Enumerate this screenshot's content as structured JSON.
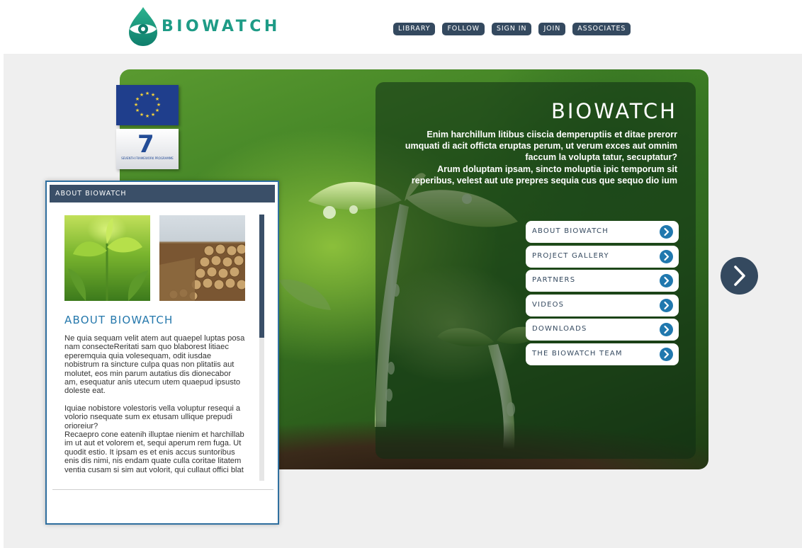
{
  "brand": {
    "name": "BIOWATCH",
    "color": "#1e9b86"
  },
  "topnav": [
    {
      "label": "LIBRARY"
    },
    {
      "label": "FOLLOW"
    },
    {
      "label": "SIGN IN"
    },
    {
      "label": "JOIN"
    },
    {
      "label": "ASSOCIATES"
    }
  ],
  "hero": {
    "title": "BIOWATCH",
    "description_1": "Enim harchillum litibus ciiscia demperuptiis et ditae prerorr umquati di acit officta eruptas perum, ut verum exces aut omnim faccum la volupta tatur, secuptatur?",
    "description_2": "Arum doluptam ipsam, sincto moluptia ipic temporum sit reperibus, velest aut ute prepres sequia cus que sequo dio ium",
    "menu": [
      {
        "label": "ABOUT BIOWATCH"
      },
      {
        "label": "PROJECT GALLERY"
      },
      {
        "label": "PARTNERS"
      },
      {
        "label": "VIDEOS"
      },
      {
        "label": "DOWNLOADS"
      },
      {
        "label": "THE BIOWATCH TEAM"
      }
    ]
  },
  "fp7": {
    "number": "7",
    "caption": "SEVENTH FRAMEWORK PROGRAMME"
  },
  "about_panel": {
    "header": "ABOUT BIOWATCH",
    "title": "ABOUT BIOWATCH",
    "paragraph_1": "Ne quia sequam velit atem aut quaepel luptas posa nam consecteReritati sam quo blaborest litiaec eperemquia quia volesequam, odit iusdae nobistrum ra sincture culpa quas non plitatiis aut molutet, eos min parum autatius dis dionecabor am, esequatur anis utecum utem quaepud ipsusto doleste eat.",
    "paragraph_2": "Iquiae nobistore volestoris vella voluptur resequi a volorio nsequate sum ex etusam ullique prepudi orioreiur?",
    "paragraph_3": "Recaepro cone eatenih illuptae nienim et harchillab im ut aut et volorem et, sequi aperum rem fuga. Ut quodit estio. It ipsam es et enis accus suntoribus enis dis nimi, nis endam quate culla coritae litatem ventia cusam si sim aut volorit, qui cullaut offici blat"
  },
  "colors": {
    "nav_bg": "#34495f",
    "accent_blue": "#2078ae",
    "stage_bg": "#efefef"
  },
  "icons": {
    "menu_arrow": "chevron-right-icon",
    "next": "chevron-right-icon"
  }
}
